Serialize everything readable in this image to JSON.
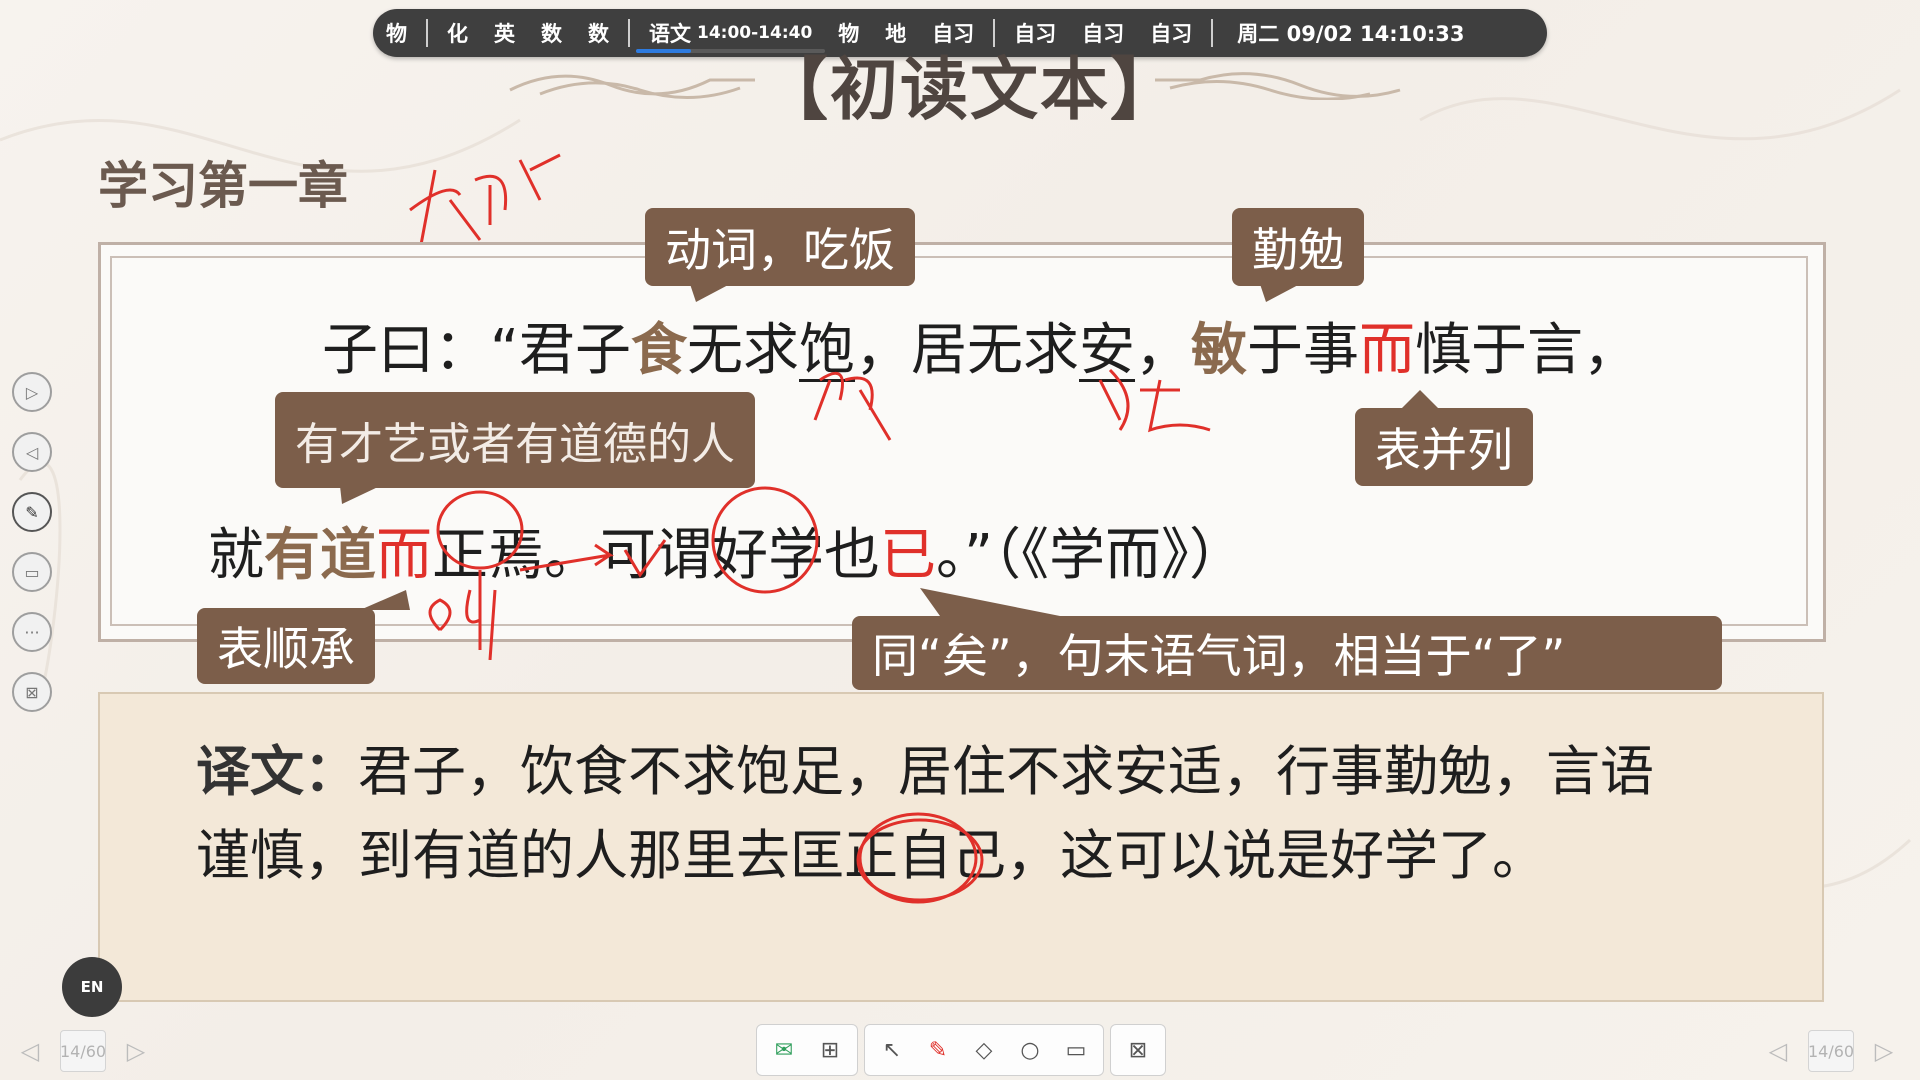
{
  "topbar": {
    "group1": [
      "物"
    ],
    "group2": [
      "化",
      "英",
      "数",
      "数"
    ],
    "current": {
      "subject": "语文",
      "time": "14:00-14:40",
      "progress": 0.29
    },
    "group3": [
      "物",
      "地",
      "自习"
    ],
    "group4": [
      "自习",
      "自习",
      "自习"
    ],
    "clock": "周二 09/02  14:10:33"
  },
  "slide": {
    "title": "【初读文本】",
    "chapter": "学习第一章",
    "line1": {
      "p1": "子曰：“君子",
      "food": "食",
      "p2": "无求",
      "full": "饱",
      "p3": "，居无求",
      "peace": "安",
      "p4": "，",
      "min": "敏",
      "p5": "于事",
      "er": "而",
      "p6": "慎于言，"
    },
    "line2": {
      "p1": "就",
      "youdao": "有道",
      "er": "而",
      "p2": "正焉。可谓",
      "haoxue": "好学",
      "p3": "也",
      "yi": "已",
      "p4": "。”（《学而》）"
    },
    "bubbles": {
      "verb": "动词，吃饭",
      "diligent": "勤勉",
      "parallel": "表并列",
      "gentleman": "有才艺或者有道德的人",
      "sequence": "表顺承",
      "particle": "同“矣”，句末语气词，相当于“了”"
    },
    "translation": {
      "label": "译文：",
      "text": "君子，饮食不求饱足，居住不求安适，行事勤勉，言语谨慎，到有道的人那里去匡正自己，这可以说是好学了。"
    }
  },
  "bottom": {
    "page_left": "14/60",
    "page_right": "14/60"
  },
  "ui": {
    "lang": "EN"
  },
  "colors": {
    "bubble": "#7c5e4a",
    "ink": "#e0302a",
    "topbar": "#3f3f3f"
  }
}
